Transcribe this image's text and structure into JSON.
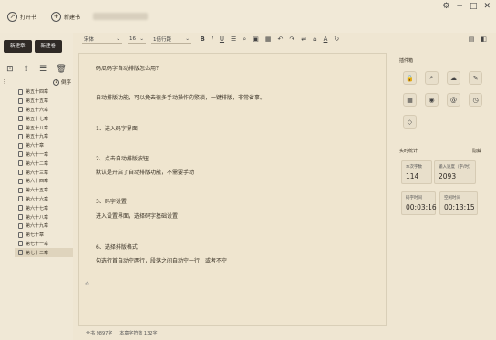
{
  "titlebar": {
    "open_label": "打开书",
    "new_label": "新建书",
    "window_controls": [
      "gear-icon",
      "minimize-icon",
      "maximize-icon",
      "close-icon"
    ]
  },
  "sidebar": {
    "new_chapter_label": "新建章",
    "new_volume_label": "新建卷",
    "sort_label": "倒序",
    "chapters": [
      "第五十四章",
      "第五十五章",
      "第五十六章",
      "第五十七章",
      "第五十八章",
      "第五十九章",
      "第六十章",
      "第六十一章",
      "第六十二章",
      "第六十三章",
      "第六十四章",
      "第六十五章",
      "第六十六章",
      "第六十七章",
      "第六十八章",
      "第六十九章",
      "第七十章",
      "第七十一章",
      "第七十二章"
    ],
    "active_index": 18
  },
  "toolbar": {
    "font": "宋体",
    "size": "16",
    "line_spacing": "1倍行距",
    "format_icons": [
      "bold-icon",
      "italic-icon",
      "underline-icon",
      "strikethrough-icon",
      "search-icon",
      "image-icon",
      "table-icon",
      "undo-icon",
      "redo-icon",
      "format-icon",
      "clear-icon",
      "font-color-icon",
      "refresh-icon"
    ],
    "right_icons": [
      "book-icon",
      "panel-icon"
    ]
  },
  "editor": {
    "lines": [
      "码瓜码字自动排版怎么用？",
      "自动排版功能，可以免去很多手动操作的繁琐，一键排版，非常省事。",
      "1、进入码字界面",
      "2、点击自动排版按钮",
      "默认是开启了自动排版功能，不需要手动",
      "3、码字设置",
      "进入设置界面，选择码字基础设置",
      "6、选择排版格式",
      "勾选行首自动空两行，段落之间自动空一行，或者不空"
    ]
  },
  "status": {
    "word_count": "全书 9897字",
    "chapter_count": "本章字符数 132字"
  },
  "right_panel": {
    "tools_title": "插件箱",
    "tools": [
      "lock-icon",
      "search-icon",
      "cloud-icon",
      "pen-icon",
      "calendar-icon",
      "target-icon",
      "mail-icon",
      "clock-icon",
      "tag-icon"
    ],
    "stats_title": "实时统计",
    "stats_hide": "隐藏",
    "stats": [
      {
        "label": "本次字数",
        "value": "114"
      },
      {
        "label": "输入速度（字/时）",
        "value": "2093"
      },
      {
        "label": "码字时间",
        "value": "00:03:16"
      },
      {
        "label": "空闲时间",
        "value": "00:13:15"
      }
    ]
  }
}
